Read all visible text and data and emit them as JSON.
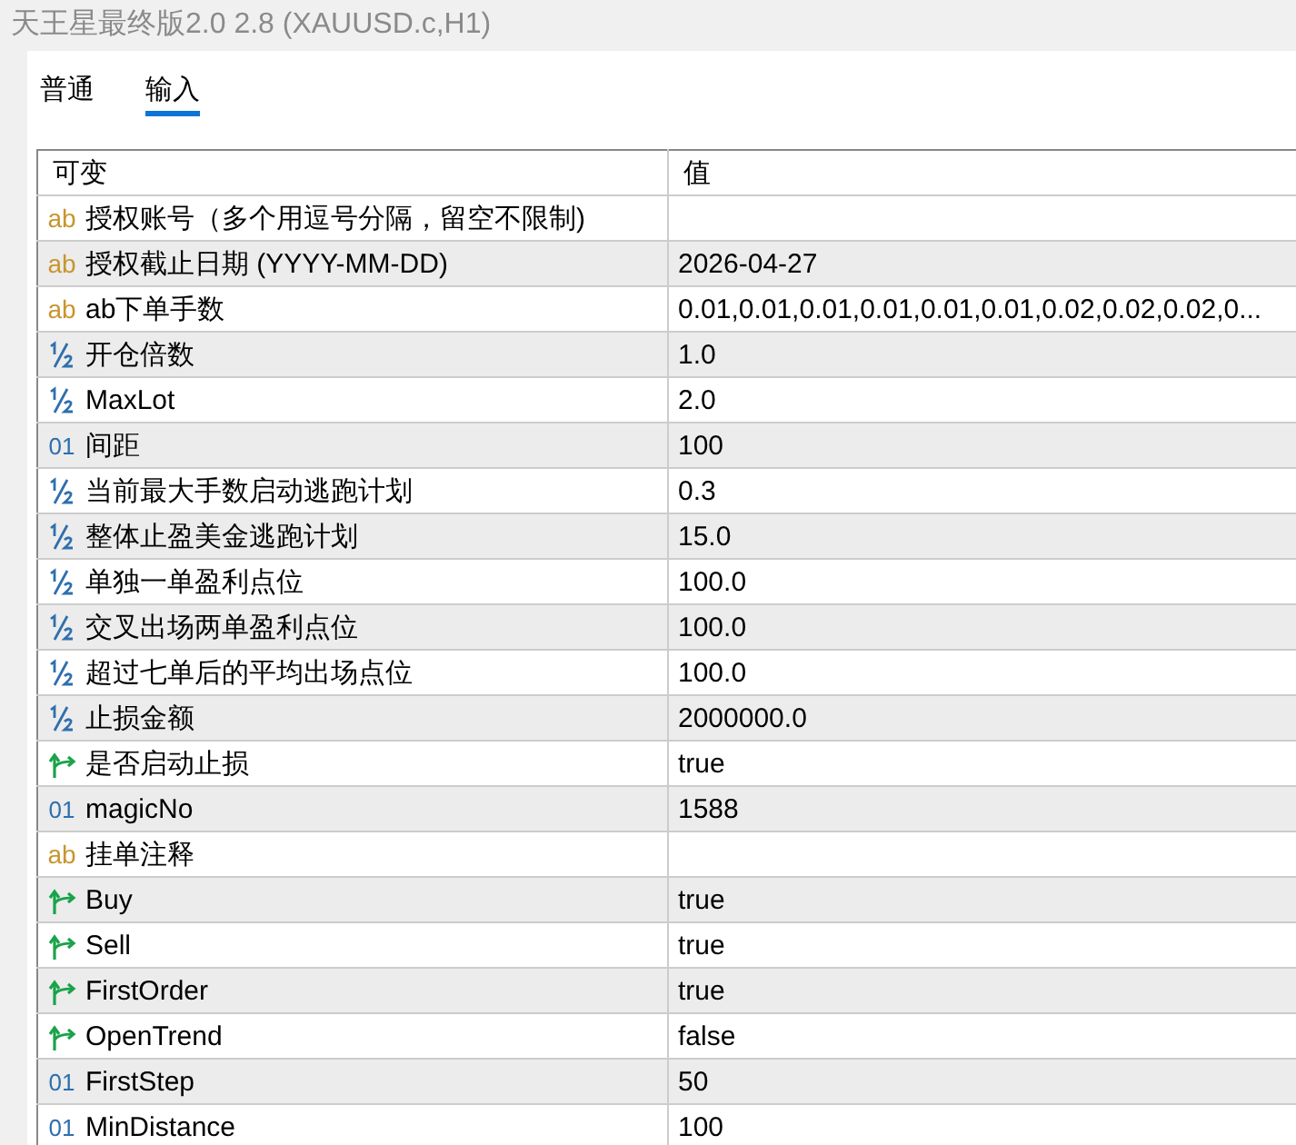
{
  "window": {
    "title": "天王星最终版2.0 2.8 (XAUUSD.c,H1)"
  },
  "tabs": [
    {
      "label": "普通",
      "selected": false
    },
    {
      "label": "输入",
      "selected": true
    }
  ],
  "table": {
    "columns": [
      "可变",
      "值"
    ],
    "rows": [
      {
        "kind": "string",
        "icon": "ab",
        "name": "授权账号（多个用逗号分隔，留空不限制)"
      },
      {
        "kind": "string",
        "icon": "ab",
        "name": "授权截止日期 (YYYY-MM-DD)",
        "value": "2026-04-27"
      },
      {
        "kind": "string",
        "icon": "ab",
        "name": "ab下单手数",
        "value": "0.01,0.01,0.01,0.01,0.01,0.01,0.02,0.02,0.02,0..."
      },
      {
        "kind": "double",
        "name": "开仓倍数",
        "value": "1.0"
      },
      {
        "kind": "double",
        "name": "MaxLot",
        "value": "2.0"
      },
      {
        "kind": "int",
        "icon": "01",
        "name": "间距",
        "value": "100"
      },
      {
        "kind": "double",
        "name": "当前最大手数启动逃跑计划",
        "value": "0.3"
      },
      {
        "kind": "double",
        "name": "整体止盈美金逃跑计划",
        "value": "15.0"
      },
      {
        "kind": "double",
        "name": "单独一单盈利点位",
        "value": "100.0"
      },
      {
        "kind": "double",
        "name": "交叉出场两单盈利点位",
        "value": "100.0"
      },
      {
        "kind": "double",
        "name": "超过七单后的平均出场点位",
        "value": "100.0"
      },
      {
        "kind": "double",
        "name": "止损金额",
        "value": "2000000.0"
      },
      {
        "kind": "bool",
        "name": "是否启动止损",
        "value": "true"
      },
      {
        "kind": "int",
        "icon": "01",
        "name": "magicNo",
        "value": "1588"
      },
      {
        "kind": "string",
        "icon": "ab",
        "name": "挂单注释"
      },
      {
        "kind": "bool",
        "name": "Buy",
        "value": "true"
      },
      {
        "kind": "bool",
        "name": "Sell",
        "value": "true"
      },
      {
        "kind": "bool",
        "name": "FirstOrder",
        "value": "true"
      },
      {
        "kind": "bool",
        "name": "OpenTrend",
        "value": "false"
      },
      {
        "kind": "int",
        "icon": "01",
        "name": "FirstStep",
        "value": "50"
      },
      {
        "kind": "int",
        "icon": "01",
        "name": "MinDistance",
        "value": "100"
      }
    ]
  }
}
